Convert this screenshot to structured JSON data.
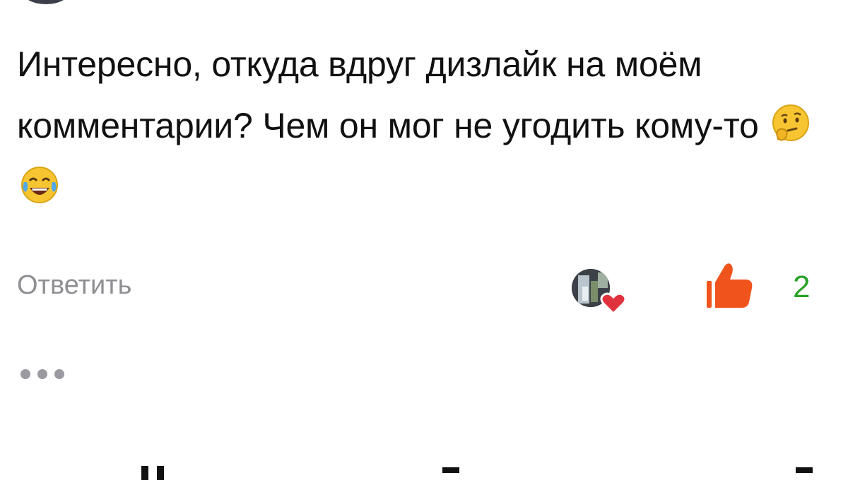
{
  "comment": {
    "text": "Интересно, откуда вдруг дизлайк на моём комментарии? Чем он мог не угодить кому-то",
    "emojis": [
      "thinking-face",
      "tears-of-joy-face"
    ]
  },
  "actions": {
    "reply_label": "Ответить",
    "like_count": "2",
    "like_color": "#f0531c",
    "count_color": "#2aa128",
    "heart_color": "#e0323c"
  },
  "more": {
    "icon": "more-dots-icon"
  }
}
